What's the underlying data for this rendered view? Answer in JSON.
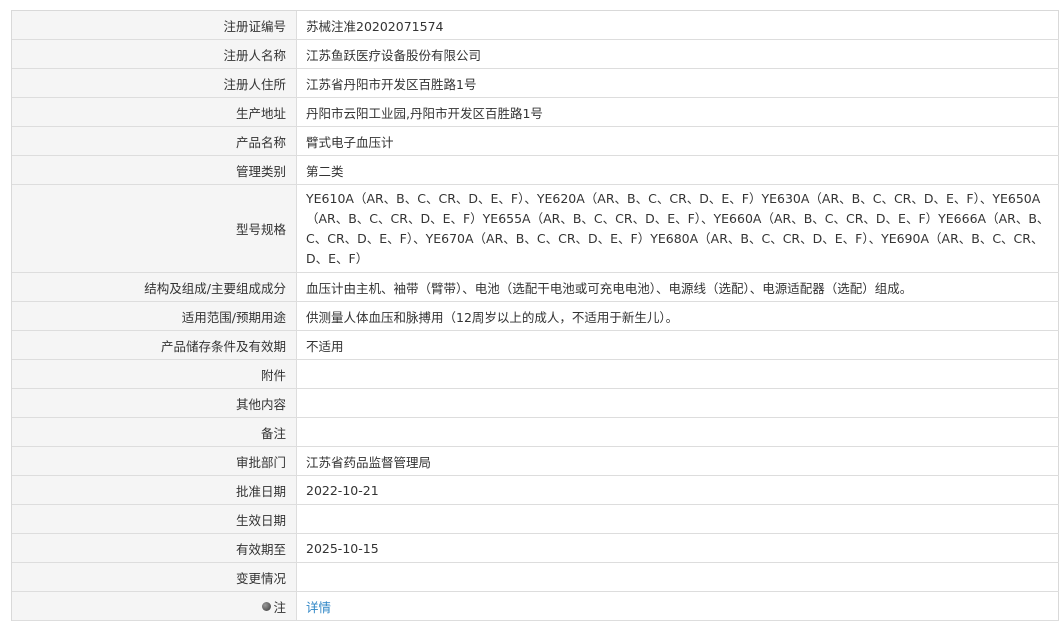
{
  "rows": [
    {
      "label": "注册证编号",
      "value": "苏械注准20202071574"
    },
    {
      "label": "注册人名称",
      "value": "江苏鱼跃医疗设备股份有限公司"
    },
    {
      "label": "注册人住所",
      "value": "江苏省丹阳市开发区百胜路1号"
    },
    {
      "label": "生产地址",
      "value": "丹阳市云阳工业园,丹阳市开发区百胜路1号"
    },
    {
      "label": "产品名称",
      "value": "臂式电子血压计"
    },
    {
      "label": "管理类别",
      "value": "第二类"
    },
    {
      "label": "型号规格",
      "value": "YE610A（AR、B、C、CR、D、E、F）、YE620A（AR、B、C、CR、D、E、F）YE630A（AR、B、C、CR、D、E、F）、YE650A（AR、B、C、CR、D、E、F）YE655A（AR、B、C、CR、D、E、F）、YE660A（AR、B、C、CR、D、E、F）YE666A（AR、B、C、CR、D、E、F）、YE670A（AR、B、C、CR、D、E、F）YE680A（AR、B、C、CR、D、E、F）、YE690A（AR、B、C、CR、D、E、F）"
    },
    {
      "label": "结构及组成/主要组成成分",
      "value": "血压计由主机、袖带（臂带）、电池（选配干电池或可充电电池）、电源线（选配）、电源适配器（选配）组成。"
    },
    {
      "label": "适用范围/预期用途",
      "value": "供测量人体血压和脉搏用（12周岁以上的成人，不适用于新生儿）。"
    },
    {
      "label": "产品储存条件及有效期",
      "value": "不适用"
    },
    {
      "label": "附件",
      "value": ""
    },
    {
      "label": "其他内容",
      "value": ""
    },
    {
      "label": "备注",
      "value": ""
    },
    {
      "label": "审批部门",
      "value": "江苏省药品监督管理局"
    },
    {
      "label": "批准日期",
      "value": "2022-10-21"
    },
    {
      "label": "生效日期",
      "value": ""
    },
    {
      "label": "有效期至",
      "value": "2025-10-15"
    },
    {
      "label": "变更情况",
      "value": ""
    }
  ],
  "note": {
    "label": "注",
    "link_text": "详情",
    "icon": "bulb-icon"
  }
}
